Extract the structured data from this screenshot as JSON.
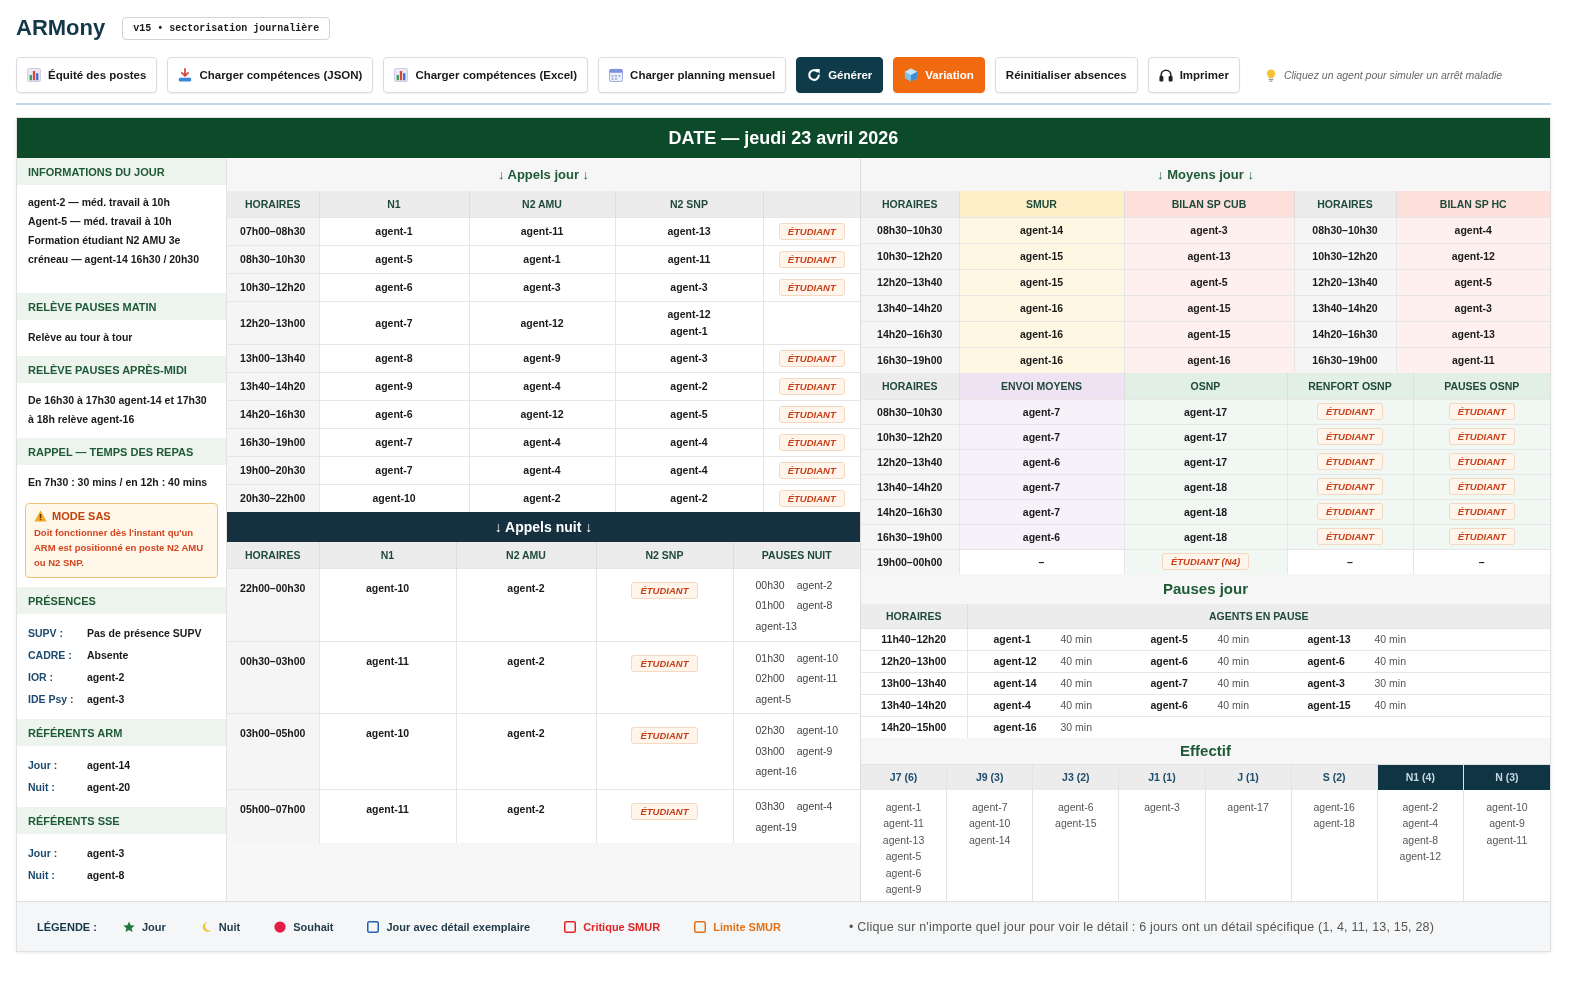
{
  "header": {
    "logo": "ARMony",
    "version_badge": "v15 • sectorisation journalière"
  },
  "toolbar": {
    "buttons": [
      {
        "label": "Équité des postes",
        "kind": "plain"
      },
      {
        "label": "Charger compétences (JSON)",
        "kind": "plain"
      },
      {
        "label": "Charger compétences (Excel)",
        "kind": "plain"
      },
      {
        "label": "Charger planning mensuel",
        "kind": "plain"
      },
      {
        "label": "Générer",
        "kind": "primary"
      },
      {
        "label": "Variation",
        "kind": "accent"
      },
      {
        "label": "Réinitialiser absences",
        "kind": "plain"
      },
      {
        "label": "Imprimer",
        "kind": "plain"
      }
    ],
    "hint": "Cliquez un agent pour simuler un arrêt maladie"
  },
  "date_bar": {
    "title": "DATE — jeudi 23 avril 2026"
  },
  "sidebar": {
    "sections": [
      {
        "title": "INFORMATIONS DU JOUR",
        "lines": [
          "agent-2 — méd. travail à 10h",
          "Agent-5 — méd. travail à 10h",
          "Formation étudiant N2 AMU 3e créneau — agent-14 16h30 / 20h30"
        ]
      },
      {
        "title": "RELÈVE PAUSES MATIN",
        "lines": [
          "Relève au tour à tour"
        ]
      },
      {
        "title": "RELÈVE PAUSES APRÈS-MIDI",
        "lines": [
          "De 16h30 à 17h30 agent-14 et 17h30 à 18h relève agent-16"
        ]
      },
      {
        "title": "RAPPEL — TEMPS DES REPAS",
        "lines": [
          "En 7h30 : 30 mins / en 12h : 40 mins"
        ],
        "alert": {
          "title": "MODE SAS",
          "text": "Doit fonctionner dès l'instant qu'un ARM est positionné en poste N2 AMU ou N2 SNP."
        }
      },
      {
        "title": "PRÉSENCES",
        "fields": [
          {
            "label": "SUPV :",
            "value": "Pas de présence SUPV"
          },
          {
            "label": "CADRE :",
            "value": "Absente"
          },
          {
            "label": "IOR :",
            "value": "agent-2"
          },
          {
            "label": "IDE Psy :",
            "value": "agent-3"
          }
        ]
      },
      {
        "title": "RÉFÉRENTS ARM",
        "fields": [
          {
            "label": "Jour :",
            "value": "agent-14"
          },
          {
            "label": "Nuit :",
            "value": "agent-20"
          }
        ]
      },
      {
        "title": "RÉFÉRENTS SSE",
        "fields": [
          {
            "label": "Jour :",
            "value": "agent-3"
          },
          {
            "label": "Nuit :",
            "value": "agent-8"
          }
        ]
      }
    ]
  },
  "appels_jour": {
    "title": "↓ Appels jour ↓",
    "columns": [
      {
        "label": "HORAIRES"
      },
      {
        "label": "N1"
      },
      {
        "label": "N2 AMU"
      },
      {
        "label": "N2 SNP"
      }
    ],
    "rows": [
      [
        {
          "kind": "time",
          "text": "07h00–08h30"
        },
        {
          "kind": "agent",
          "text": "agent-1"
        },
        {
          "kind": "agent",
          "text": "agent-11"
        },
        {
          "kind": "agent",
          "text": "agent-13"
        },
        {
          "kind": "badge",
          "text": "ÉTUDIANT"
        }
      ],
      [
        {
          "kind": "time",
          "text": "08h30–10h30"
        },
        {
          "kind": "agent",
          "text": "agent-5"
        },
        {
          "kind": "agent",
          "text": "agent-1"
        },
        {
          "kind": "agent",
          "text": "agent-11"
        },
        {
          "kind": "badge",
          "text": "ÉTUDIANT"
        }
      ],
      [
        {
          "kind": "time",
          "text": "10h30–12h20"
        },
        {
          "kind": "agent",
          "text": "agent-6"
        },
        {
          "kind": "agent",
          "text": "agent-3"
        },
        {
          "kind": "agent",
          "text": "agent-3"
        },
        {
          "kind": "badge",
          "text": "ÉTUDIANT"
        }
      ],
      [
        {
          "kind": "time",
          "text": "12h20–13h00"
        },
        {
          "kind": "agent",
          "text": "agent-7"
        },
        {
          "kind": "agent",
          "text": "agent-12"
        },
        {
          "kind": "agents",
          "lines": [
            "agent-12",
            "agent-1"
          ]
        },
        {
          "kind": "empty"
        }
      ],
      [
        {
          "kind": "time",
          "text": "13h00–13h40"
        },
        {
          "kind": "agent",
          "text": "agent-8"
        },
        {
          "kind": "agent",
          "text": "agent-9"
        },
        {
          "kind": "agent",
          "text": "agent-3"
        },
        {
          "kind": "badge",
          "text": "ÉTUDIANT"
        }
      ],
      [
        {
          "kind": "time",
          "text": "13h40–14h20"
        },
        {
          "kind": "agent",
          "text": "agent-9"
        },
        {
          "kind": "agent",
          "text": "agent-4"
        },
        {
          "kind": "agent",
          "text": "agent-2"
        },
        {
          "kind": "badge",
          "text": "ÉTUDIANT"
        }
      ],
      [
        {
          "kind": "time",
          "text": "14h20–16h30"
        },
        {
          "kind": "agent",
          "text": "agent-6"
        },
        {
          "kind": "agent",
          "text": "agent-12"
        },
        {
          "kind": "agent",
          "text": "agent-5"
        },
        {
          "kind": "badge",
          "text": "ÉTUDIANT"
        }
      ],
      [
        {
          "kind": "time",
          "text": "16h30–19h00"
        },
        {
          "kind": "agent",
          "text": "agent-7"
        },
        {
          "kind": "agent",
          "text": "agent-4"
        },
        {
          "kind": "agent",
          "text": "agent-4"
        },
        {
          "kind": "badge",
          "text": "ÉTUDIANT"
        }
      ],
      [
        {
          "kind": "time",
          "text": "19h00–20h30"
        },
        {
          "kind": "agent",
          "text": "agent-7"
        },
        {
          "kind": "agent",
          "text": "agent-4"
        },
        {
          "kind": "agent",
          "text": "agent-4"
        },
        {
          "kind": "badge",
          "text": "ÉTUDIANT"
        }
      ],
      [
        {
          "kind": "time",
          "text": "20h30–22h00"
        },
        {
          "kind": "agent",
          "text": "agent-10"
        },
        {
          "kind": "agent",
          "text": "agent-2"
        },
        {
          "kind": "agent",
          "text": "agent-2"
        },
        {
          "kind": "badge",
          "text": "ÉTUDIANT"
        }
      ]
    ]
  },
  "appels_nuit": {
    "title": "↓ Appels nuit ↓",
    "columns": [
      {
        "label": "HORAIRES"
      },
      {
        "label": "N1"
      },
      {
        "label": "N2 AMU"
      },
      {
        "label": "N2 SNP"
      },
      {
        "label": "PAUSES NUIT"
      }
    ],
    "rows": [
      [
        {
          "kind": "time",
          "text": "22h00–00h30"
        },
        {
          "kind": "agent",
          "text": "agent-10"
        },
        {
          "kind": "agent",
          "text": "agent-2"
        },
        {
          "kind": "badge",
          "text": "ÉTUDIANT"
        },
        {
          "kind": "pauses",
          "entries": [
            {
              "time": "00h30",
              "agent": "agent-2"
            },
            {
              "time": "01h00",
              "agent": "agent-8"
            },
            {
              "agent": "agent-13"
            }
          ]
        }
      ],
      [
        {
          "kind": "time",
          "text": "00h30–03h00"
        },
        {
          "kind": "agent",
          "text": "agent-11"
        },
        {
          "kind": "agent",
          "text": "agent-2"
        },
        {
          "kind": "badge",
          "text": "ÉTUDIANT"
        },
        {
          "kind": "pauses",
          "entries": [
            {
              "time": "01h30",
              "agent": "agent-10"
            },
            {
              "time": "02h00",
              "agent": "agent-11"
            },
            {
              "agent": "agent-5"
            }
          ]
        }
      ],
      [
        {
          "kind": "time",
          "text": "03h00–05h00"
        },
        {
          "kind": "agent",
          "text": "agent-10"
        },
        {
          "kind": "agent",
          "text": "agent-2"
        },
        {
          "kind": "badge",
          "text": "ÉTUDIANT"
        },
        {
          "kind": "pauses",
          "entries": [
            {
              "time": "02h30",
              "agent": "agent-10"
            },
            {
              "time": "03h00",
              "agent": "agent-9"
            },
            {
              "agent": "agent-16"
            }
          ]
        }
      ],
      [
        {
          "kind": "time",
          "text": "05h00–07h00"
        },
        {
          "kind": "agent",
          "text": "agent-11"
        },
        {
          "kind": "agent",
          "text": "agent-2"
        },
        {
          "kind": "badge",
          "text": "ÉTUDIANT"
        },
        {
          "kind": "pauses",
          "entries": [
            {
              "time": "03h30",
              "agent": "agent-4"
            },
            {
              "agent": "agent-19"
            }
          ]
        }
      ]
    ]
  },
  "moyens_jour": {
    "title": "↓ Moyens jour ↓",
    "tables": [
      {
        "columns": [
          {
            "label": "HORAIRES"
          },
          {
            "label": "SMUR",
            "color": "#fdefc8"
          },
          {
            "label": "BILAN SP CUB",
            "color": "#fde0dc"
          },
          {
            "label": "HORAIRES"
          },
          {
            "label": "BILAN SP HC",
            "color": "#fde0dc"
          }
        ],
        "rows": [
          [
            {
              "kind": "time",
              "text": "08h30–10h30"
            },
            {
              "kind": "agent",
              "text": "agent-14"
            },
            {
              "kind": "agent",
              "text": "agent-3"
            },
            {
              "kind": "time",
              "text": "08h30–10h30"
            },
            {
              "kind": "agent",
              "text": "agent-4"
            }
          ],
          [
            {
              "kind": "time",
              "text": "10h30–12h20"
            },
            {
              "kind": "agent",
              "text": "agent-15"
            },
            {
              "kind": "agent",
              "text": "agent-13"
            },
            {
              "kind": "time",
              "text": "10h30–12h20"
            },
            {
              "kind": "agent",
              "text": "agent-12"
            }
          ],
          [
            {
              "kind": "time",
              "text": "12h20–13h40"
            },
            {
              "kind": "agent",
              "text": "agent-15"
            },
            {
              "kind": "agent",
              "text": "agent-5"
            },
            {
              "kind": "time",
              "text": "12h20–13h40"
            },
            {
              "kind": "agent",
              "text": "agent-5"
            }
          ],
          [
            {
              "kind": "time",
              "text": "13h40–14h20"
            },
            {
              "kind": "agent",
              "text": "agent-16"
            },
            {
              "kind": "agent",
              "text": "agent-15"
            },
            {
              "kind": "time",
              "text": "13h40–14h20"
            },
            {
              "kind": "agent",
              "text": "agent-3"
            }
          ],
          [
            {
              "kind": "time",
              "text": "14h20–16h30"
            },
            {
              "kind": "agent",
              "text": "agent-16"
            },
            {
              "kind": "agent",
              "text": "agent-15"
            },
            {
              "kind": "time",
              "text": "14h20–16h30"
            },
            {
              "kind": "agent",
              "text": "agent-13"
            }
          ],
          [
            {
              "kind": "time",
              "text": "16h30–19h00"
            },
            {
              "kind": "agent",
              "text": "agent-16"
            },
            {
              "kind": "agent",
              "text": "agent-16"
            },
            {
              "kind": "time",
              "text": "16h30–19h00"
            },
            {
              "kind": "agent",
              "text": "agent-11"
            }
          ]
        ]
      },
      {
        "columns": [
          {
            "label": "HORAIRES"
          },
          {
            "label": "ENVOI MOYENS",
            "color": "#eee2f3"
          },
          {
            "label": "OSNP",
            "color": "#e2efe5"
          },
          {
            "label": "RENFORT OSNP",
            "color": "#e2efe5"
          },
          {
            "label": "PAUSES OSNP",
            "color": "#e2efe5"
          }
        ],
        "rows": [
          [
            {
              "kind": "time",
              "text": "08h30–10h30"
            },
            {
              "kind": "agent",
              "text": "agent-7"
            },
            {
              "kind": "agent",
              "text": "agent-17"
            },
            {
              "kind": "badge",
              "text": "ÉTUDIANT"
            },
            {
              "kind": "badge",
              "text": "ÉTUDIANT"
            }
          ],
          [
            {
              "kind": "time",
              "text": "10h30–12h20"
            },
            {
              "kind": "agent",
              "text": "agent-7"
            },
            {
              "kind": "agent",
              "text": "agent-17"
            },
            {
              "kind": "badge",
              "text": "ÉTUDIANT"
            },
            {
              "kind": "badge",
              "text": "ÉTUDIANT"
            }
          ],
          [
            {
              "kind": "time",
              "text": "12h20–13h40"
            },
            {
              "kind": "agent",
              "text": "agent-6"
            },
            {
              "kind": "agent",
              "text": "agent-17"
            },
            {
              "kind": "badge",
              "text": "ÉTUDIANT"
            },
            {
              "kind": "badge",
              "text": "ÉTUDIANT"
            }
          ],
          [
            {
              "kind": "time",
              "text": "13h40–14h20"
            },
            {
              "kind": "agent",
              "text": "agent-7"
            },
            {
              "kind": "agent",
              "text": "agent-18"
            },
            {
              "kind": "badge",
              "text": "ÉTUDIANT"
            },
            {
              "kind": "badge",
              "text": "ÉTUDIANT"
            }
          ],
          [
            {
              "kind": "time",
              "text": "14h20–16h30"
            },
            {
              "kind": "agent",
              "text": "agent-7"
            },
            {
              "kind": "agent",
              "text": "agent-18"
            },
            {
              "kind": "badge",
              "text": "ÉTUDIANT"
            },
            {
              "kind": "badge",
              "text": "ÉTUDIANT"
            }
          ],
          [
            {
              "kind": "time",
              "text": "16h30–19h00"
            },
            {
              "kind": "agent",
              "text": "agent-6"
            },
            {
              "kind": "agent",
              "text": "agent-18"
            },
            {
              "kind": "badge",
              "text": "ÉTUDIANT"
            },
            {
              "kind": "badge",
              "text": "ÉTUDIANT"
            }
          ],
          [
            {
              "kind": "time",
              "text": "19h00–00h00"
            },
            {
              "kind": "dash",
              "text": "–"
            },
            {
              "kind": "badge",
              "text": "ÉTUDIANT (N4)"
            },
            {
              "kind": "dash",
              "text": "–"
            },
            {
              "kind": "dash",
              "text": "–"
            }
          ]
        ]
      }
    ]
  },
  "pauses_jour": {
    "title": "Pauses jour",
    "columns": [
      {
        "label": "HORAIRES"
      },
      {
        "label": "AGENTS EN PAUSE"
      }
    ],
    "rows": [
      {
        "time": "11h40–12h20",
        "pauses": [
          {
            "agent": "agent-1",
            "duration": "40 min"
          },
          {
            "agent": "agent-5",
            "duration": "40 min"
          },
          {
            "agent": "agent-13",
            "duration": "40 min"
          }
        ]
      },
      {
        "time": "12h20–13h00",
        "pauses": [
          {
            "agent": "agent-12",
            "duration": "40 min"
          },
          {
            "agent": "agent-6",
            "duration": "40 min"
          },
          {
            "agent": "agent-6",
            "duration": "40 min"
          }
        ]
      },
      {
        "time": "13h00–13h40",
        "pauses": [
          {
            "agent": "agent-14",
            "duration": "40 min"
          },
          {
            "agent": "agent-7",
            "duration": "40 min"
          },
          {
            "agent": "agent-3",
            "duration": "30 min"
          }
        ]
      },
      {
        "time": "13h40–14h20",
        "pauses": [
          {
            "agent": "agent-4",
            "duration": "40 min"
          },
          {
            "agent": "agent-6",
            "duration": "40 min"
          },
          {
            "agent": "agent-15",
            "duration": "40 min"
          }
        ]
      },
      {
        "time": "14h20–15h00",
        "pauses": [
          {
            "agent": "agent-16",
            "duration": "30 min"
          }
        ]
      }
    ]
  },
  "effectif": {
    "title": "Effectif",
    "groups": [
      {
        "label": "J7 (6)",
        "night": false,
        "agents": [
          "agent-1",
          "agent-11",
          "agent-13",
          "agent-5",
          "agent-6",
          "agent-9"
        ]
      },
      {
        "label": "J9 (3)",
        "night": false,
        "agents": [
          "agent-7",
          "agent-10",
          "agent-14"
        ]
      },
      {
        "label": "J3 (2)",
        "night": false,
        "agents": [
          "agent-6",
          "agent-15"
        ]
      },
      {
        "label": "J1 (1)",
        "night": false,
        "agents": [
          "agent-3"
        ]
      },
      {
        "label": "J (1)",
        "night": false,
        "agents": [
          "agent-17"
        ]
      },
      {
        "label": "S (2)",
        "night": false,
        "agents": [
          "agent-16",
          "agent-18"
        ]
      },
      {
        "label": "N1 (4)",
        "night": true,
        "agents": [
          "agent-2",
          "agent-4",
          "agent-8",
          "agent-12"
        ]
      },
      {
        "label": "N (3)",
        "night": true,
        "agents": [
          "agent-10",
          "agent-9",
          "agent-11"
        ]
      }
    ]
  },
  "legend": {
    "title": "LÉGENDE :",
    "items": [
      {
        "kind": "star",
        "color": "#1e7a3c",
        "label": "Jour",
        "tinted_label": false
      },
      {
        "kind": "moon",
        "color": "#f2c230",
        "label": "Nuit",
        "tinted_label": false
      },
      {
        "kind": "dot",
        "color": "#e11d48",
        "label": "Souhait",
        "tinted_label": false
      },
      {
        "kind": "square",
        "color": "#2563a8",
        "label": "Jour avec détail exemplaire",
        "tinted_label": false
      },
      {
        "kind": "square",
        "color": "#e02424",
        "label": "Critique SMUR",
        "tinted_label": true
      },
      {
        "kind": "square",
        "color": "#e0731a",
        "label": "Limite SMUR",
        "tinted_label": true
      }
    ],
    "note": "• Clique sur n'importe quel jour pour voir le détail : 6 jours ont un détail spécifique (1, 4, 11, 13, 15, 28)"
  }
}
